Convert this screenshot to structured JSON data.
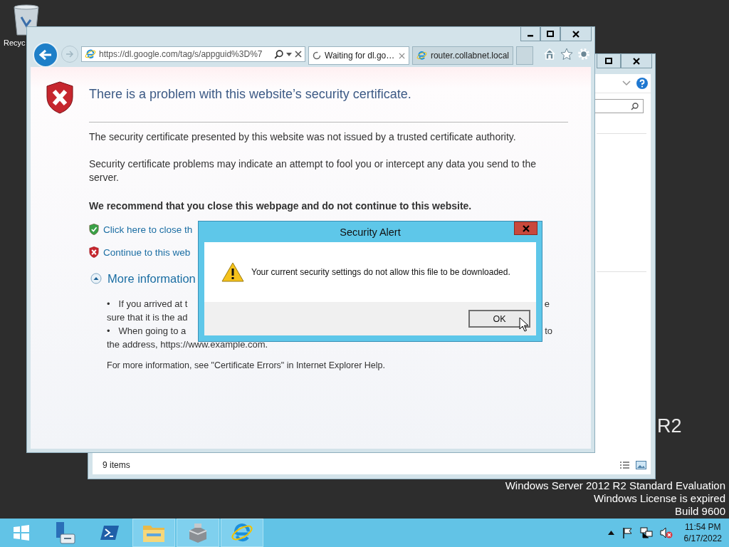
{
  "desktop": {
    "icon_label": "Recyc",
    "watermark": "R2",
    "edition_lines": [
      "Windows Server 2012 R2 Standard Evaluation",
      "Windows License is expired",
      "Build 9600"
    ]
  },
  "explorer": {
    "status": "9 items"
  },
  "browser": {
    "forward_disabled": true,
    "address": "https://dl.google.com/tag/s/appguid%3D%7",
    "tabs": [
      {
        "label": "Waiting for dl.go…",
        "selected": true,
        "loading": true
      },
      {
        "label": "router.collabnet.local",
        "selected": false,
        "loading": false
      }
    ]
  },
  "page": {
    "title": "There is a problem with this website’s security certificate.",
    "paragraphs": [
      "The security certificate presented by this website was not issued by a trusted certificate authority.",
      "Security certificate problems may indicate an attempt to fool you or intercept any data you send to the server."
    ],
    "recommendation": "We recommend that you close this webpage and do not continue to this website.",
    "links": [
      {
        "kind": "safe",
        "text": "Click here to close th"
      },
      {
        "kind": "unsafe",
        "text": "Continue to this web"
      }
    ],
    "more_info": {
      "label": "More information",
      "expanded": true,
      "bullets": [
        {
          "marker": "•",
          "text": "If you arrived at t",
          "tail": "e",
          "continuation": "sure that it is the ad"
        },
        {
          "marker": "•",
          "text": "When going to a",
          "tail": "to",
          "continuation": "the address, https://www.example.com."
        }
      ],
      "footer": "For more information, see \"Certificate Errors\" in Internet Explorer Help."
    }
  },
  "dialog": {
    "title": "Security Alert",
    "message": "Your current security settings do not allow this file to be downloaded.",
    "button": "OK"
  },
  "taskbar": {
    "apps": [
      {
        "kind": "start",
        "open": false
      },
      {
        "kind": "server-manager",
        "open": false
      },
      {
        "kind": "powershell",
        "open": false
      },
      {
        "kind": "file-explorer",
        "open": true
      },
      {
        "kind": "toolbox",
        "open": true
      },
      {
        "kind": "ie",
        "open": true
      }
    ],
    "volume_muted": true,
    "time": "11:54 PM",
    "date": "6/17/2022"
  }
}
